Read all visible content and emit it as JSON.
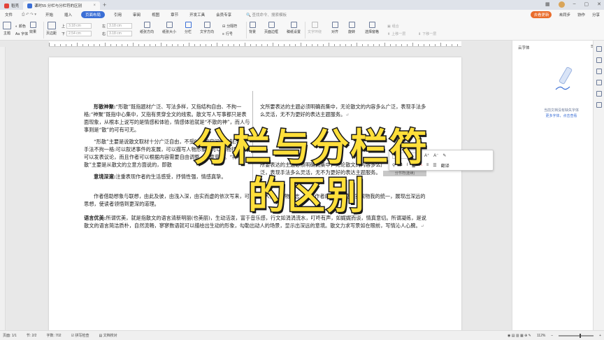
{
  "titlebar": {
    "tab1": "稻壳",
    "tab2": "课时55 分栏与分栏符的区别",
    "new_tab": "+"
  },
  "menubar": {
    "file": "文件",
    "items": [
      "开始",
      "插入",
      "页面布局",
      "引用",
      "审阅",
      "视图",
      "章节",
      "开发工具",
      "会员专享"
    ],
    "active_index": 2,
    "search": "查找命令、搜索模板",
    "right": [
      "未同步",
      "协作",
      "分享"
    ],
    "badge": "去看更新"
  },
  "toolbar": {
    "theme": "主题",
    "color": "颜色",
    "font": "字体",
    "effect": "效果",
    "margin": "页边距",
    "top_val": "3.18 cm",
    "bottom_val": "2.54 cm",
    "left_val": "3.18 cm",
    "right_val": "3.18 cm",
    "orientation": "纸张方向",
    "size": "纸张大小",
    "columns": "分栏",
    "text_dir": "文字方向",
    "line_num": "行号",
    "separator": "分隔符",
    "background": "背景",
    "page_border": "页面边框",
    "draft": "稿纸设置",
    "wrap": "文字环绕",
    "align": "对齐",
    "rotate": "旋转",
    "select_pane": "选择窗格",
    "group": "组合",
    "up": "上移一层",
    "down": "下移一层"
  },
  "document": {
    "left_col": {
      "p1_bold": "形散神聚:",
      "p1": "“形散”既指题材广泛、写法多样，又指结构自由、不拘一格;“神聚”既指中心集中，又指有贯穿全文的线索。散文写人写事都只是表面现象，从根本上说写的是情感和体验，情感体验就是“不散的神”，而人与事则是“散”的可有可无。",
      "p2": "“形散”主要是说散文取材十分广泛自由，不受时间和空间的限制;表现手法不拘一格:可以叙述事件的发展，可以描写人物形象，可以托物抒情，可以发表议论，而且作者可以根据内容需要自由调整、随意变化。“神不散”主要是从散文的立意方面说的，即散",
      "p3_bold": "意境深邃:",
      "p3": "注重表现作者的生活感受，抒情性强，情感真挚。"
    },
    "right_col": {
      "p1": "文所要表达的主题必须明确而集中，无论散文的内容多么广泛，表现手法多么灵活，无不为更好的表达主题服务。",
      "p2": "所要表达的主题必须明确而集中，无论散文的内容多么广泛，表现手法多么灵活，无不为更好的表达主题服务。",
      "section_break": "分节符(连续)"
    },
    "full_p1": "作者借助想象与联想，由此及彼，由浅入深，由实而虚的依次写来，可以融情入景、托物言志，表达作者的真情实感，实现物我的统一，展现出深远的思想，使读者领悟到更深的道理。",
    "full_p2_bold": "语言优美:",
    "full_p2": "所谓优美，就是指散文的语言清新明丽(也美丽)，生动活泼，富于音乐感，行文如涓涓流水，叮咚有声，如娓娓而谈，情真意切。所谓凝练，是说散文的语言简洁质朴，自然流畅，寥寥数语就可以描绘出生动的形象，勾勒出动人的场景，显示出深远的意境。散文力求写景如在眼前，写情沁人心脾。",
    "para_mark": "↵"
  },
  "mini_toolbar": {
    "font_size": "小四",
    "label_translate": "翻译"
  },
  "overlay": {
    "line1": "分栏与分栏符",
    "line2": "的区别"
  },
  "right_panel": {
    "title": "云字体",
    "msg1": "当前文档没有缺失字体",
    "link": "更多字体，点击查看"
  },
  "statusbar": {
    "page": "页面: 1/1",
    "section": "节: 2/2",
    "words": "字数: 702",
    "spell": "拼写检查",
    "proof": "文档校对",
    "zoom": "112%"
  },
  "colors": {
    "accent": "#3b6fd6",
    "overlay_text": "#ffdf3a"
  }
}
